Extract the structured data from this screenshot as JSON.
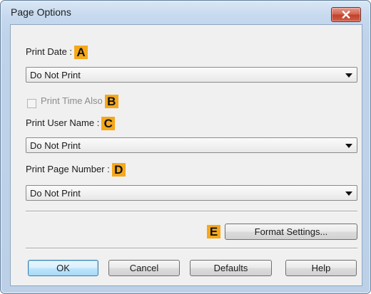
{
  "window": {
    "title": "Page Options"
  },
  "colors": {
    "tag": "#f6a81a",
    "close": "#c0412b",
    "frame": "#bcd1e8",
    "client": "#f0f0f0"
  },
  "print_date": {
    "label": "Print Date :",
    "tag": "A",
    "value": "Do Not Print"
  },
  "print_time": {
    "label": "Print Time Also",
    "tag": "B",
    "checked": false,
    "enabled": false
  },
  "print_user": {
    "label": "Print User Name :",
    "tag": "C",
    "value": "Do Not Print"
  },
  "print_page": {
    "label": "Print Page Number :",
    "tag": "D",
    "value": "Do Not Print"
  },
  "format": {
    "tag": "E",
    "button_label": "Format Settings..."
  },
  "buttons": {
    "ok": "OK",
    "cancel": "Cancel",
    "defaults": "Defaults",
    "help": "Help"
  },
  "icons": {
    "close": "close-icon",
    "dropdown": "chevron-down-icon"
  }
}
